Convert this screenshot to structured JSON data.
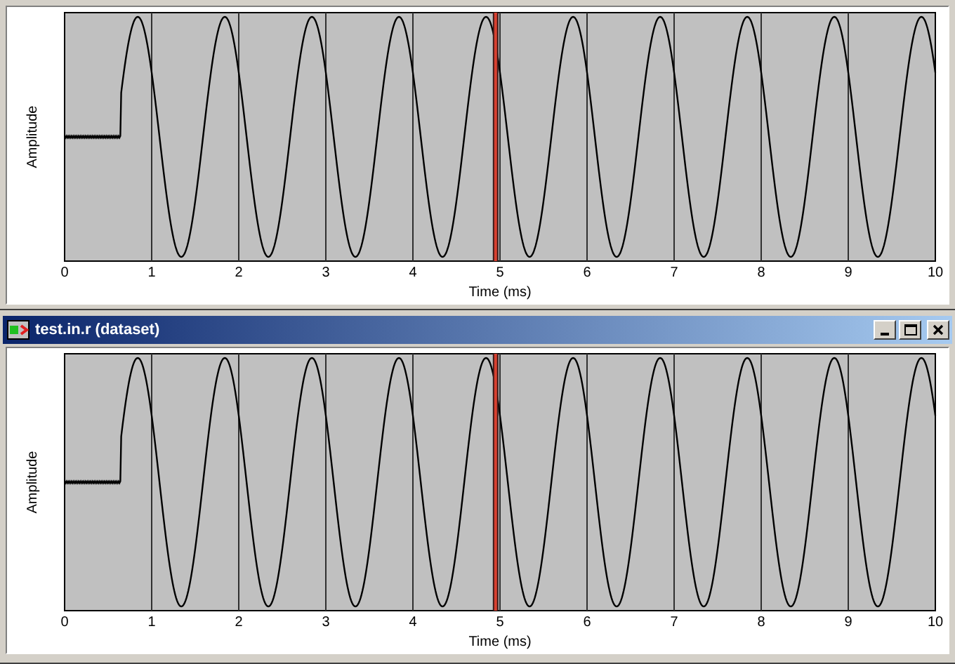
{
  "windows": [
    {
      "plot": {
        "ylabel": "Amplitude",
        "xlabel": "Time (ms)",
        "xticks": [
          "0",
          "1",
          "2",
          "3",
          "4",
          "5",
          "6",
          "7",
          "8",
          "9",
          "10"
        ],
        "cursor_shown": true
      }
    },
    {
      "title": "test.in.r (dataset)",
      "window_buttons": [
        {
          "kind": "minimize"
        },
        {
          "kind": "maximize"
        },
        {
          "kind": "close"
        }
      ],
      "plot": {
        "ylabel": "Amplitude",
        "xlabel": "Time (ms)",
        "xticks": [
          "0",
          "1",
          "2",
          "3",
          "4",
          "5",
          "6",
          "7",
          "8",
          "9",
          "10"
        ],
        "cursor_shown": true
      }
    }
  ]
}
